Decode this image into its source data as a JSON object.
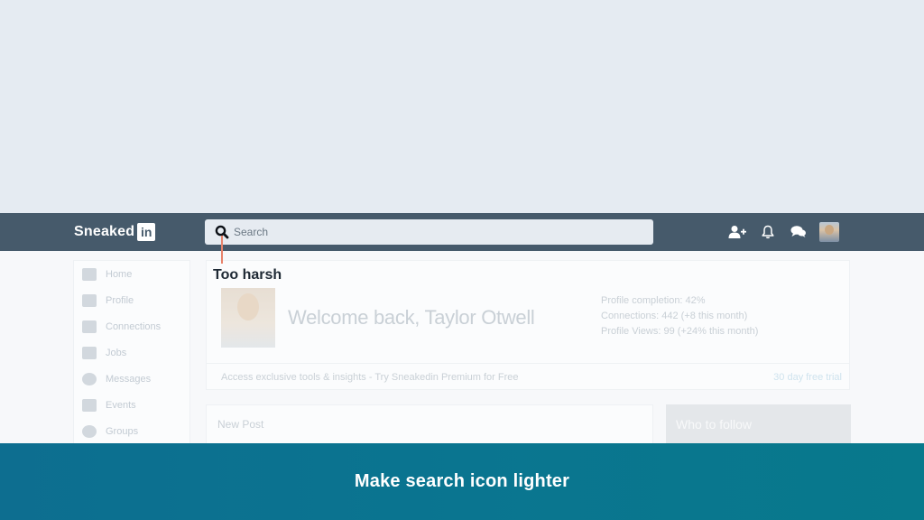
{
  "navbar": {
    "logo_text": "Sneaked",
    "logo_badge": "in",
    "search_placeholder": "Search",
    "icons": [
      "add-user-icon",
      "bell-icon",
      "chat-icon",
      "avatar"
    ]
  },
  "sidebar": {
    "items": [
      {
        "label": "Home",
        "icon": "home-icon"
      },
      {
        "label": "Profile",
        "icon": "profile-card-icon"
      },
      {
        "label": "Connections",
        "icon": "handshake-icon"
      },
      {
        "label": "Jobs",
        "icon": "briefcase-icon"
      },
      {
        "label": "Messages",
        "icon": "messages-icon"
      },
      {
        "label": "Events",
        "icon": "calendar-icon"
      },
      {
        "label": "Groups",
        "icon": "group-icon"
      }
    ]
  },
  "welcome": {
    "title": "Welcome back, Taylor Otwell",
    "stats": [
      "Profile completion: 42%",
      "Connections: 442 (+8 this month)",
      "Profile Views: 99 (+24% this month)"
    ],
    "promo_text": "Access exclusive tools & insights - Try Sneakedin Premium for Free",
    "promo_link": "30 day free trial"
  },
  "post": {
    "label": "New Post"
  },
  "follow": {
    "label": "Who to follow"
  },
  "annotation": {
    "label": "Too harsh",
    "color": "#e8826a"
  },
  "caption": {
    "text": "Make search icon lighter"
  },
  "colors": {
    "navbar": "#465a6b",
    "search_bg": "#e6ebf1",
    "caption_bg": "#0a7590",
    "page_bg": "#e5ebf2"
  }
}
